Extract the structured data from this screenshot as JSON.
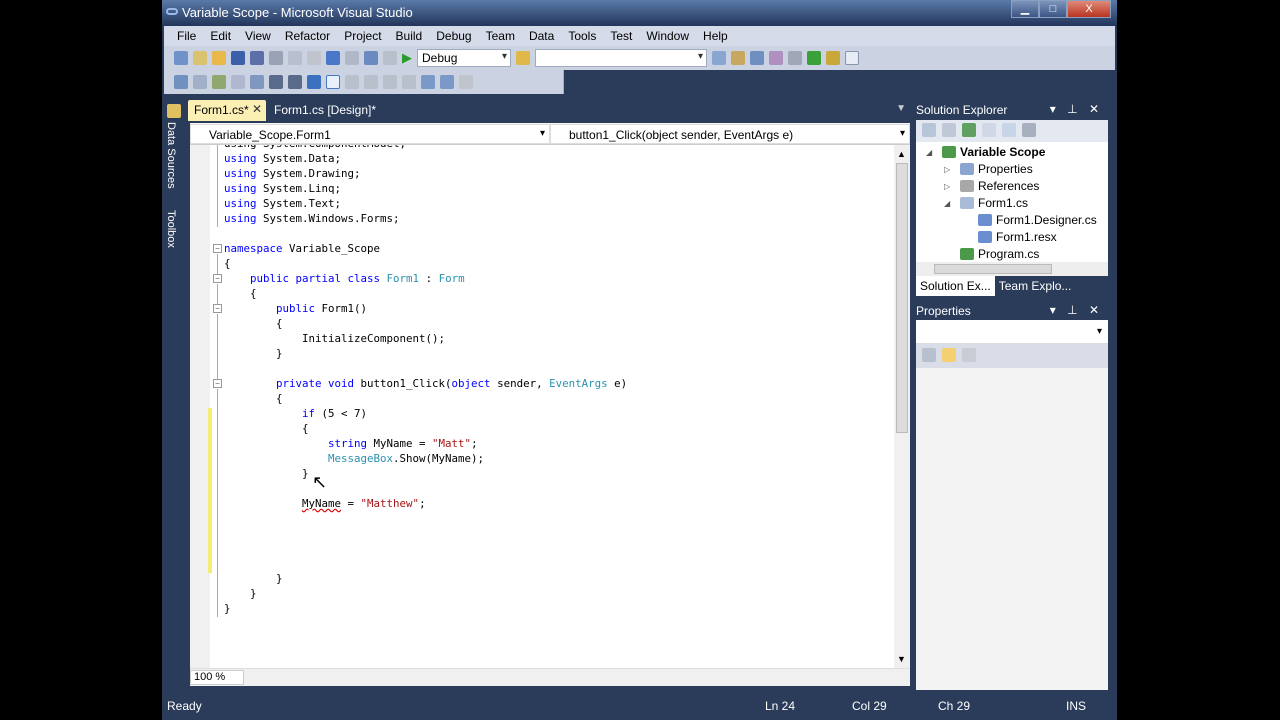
{
  "window": {
    "title": "Variable Scope - Microsoft Visual Studio",
    "min": "▁",
    "max": "□",
    "close": "X"
  },
  "menu": [
    "File",
    "Edit",
    "View",
    "Refactor",
    "Project",
    "Build",
    "Debug",
    "Team",
    "Data",
    "Tools",
    "Test",
    "Window",
    "Help"
  ],
  "toolbar": {
    "config": "Debug",
    "platform": ""
  },
  "tabs": [
    {
      "label": "Form1.cs*",
      "close": "✕"
    },
    {
      "label": "Form1.cs [Design]*"
    }
  ],
  "side": {
    "data_sources": "Data Sources",
    "toolbox": "Toolbox"
  },
  "nav": {
    "type": "Variable_Scope.Form1",
    "member": "button1_Click(object sender, EventArgs e)"
  },
  "code": [
    [
      [
        "",
        "using System.ComponentModel;"
      ]
    ],
    [
      [
        "kw",
        "using"
      ],
      [
        "",
        " System.Data;"
      ]
    ],
    [
      [
        "kw",
        "using"
      ],
      [
        "",
        " System.Drawing;"
      ]
    ],
    [
      [
        "kw",
        "using"
      ],
      [
        "",
        " System.Linq;"
      ]
    ],
    [
      [
        "kw",
        "using"
      ],
      [
        "",
        " System.Text;"
      ]
    ],
    [
      [
        "kw",
        "using"
      ],
      [
        "",
        " System.Windows.Forms;"
      ]
    ],
    [],
    [
      [
        "kw",
        "namespace"
      ],
      [
        "",
        " Variable_Scope"
      ]
    ],
    [
      [
        "",
        "{"
      ]
    ],
    [
      [
        "",
        "    "
      ],
      [
        "kw",
        "public partial class"
      ],
      [
        "",
        " "
      ],
      [
        "ty",
        "Form1"
      ],
      [
        "",
        " : "
      ],
      [
        "ty",
        "Form"
      ]
    ],
    [
      [
        "",
        "    {"
      ]
    ],
    [
      [
        "",
        "        "
      ],
      [
        "kw",
        "public"
      ],
      [
        "",
        " Form1()"
      ]
    ],
    [
      [
        "",
        "        {"
      ]
    ],
    [
      [
        "",
        "            InitializeComponent();"
      ]
    ],
    [
      [
        "",
        "        }"
      ]
    ],
    [],
    [
      [
        "",
        "        "
      ],
      [
        "kw",
        "private void"
      ],
      [
        "",
        " button1_Click("
      ],
      [
        "kw",
        "object"
      ],
      [
        "",
        " sender, "
      ],
      [
        "ty",
        "EventArgs"
      ],
      [
        "",
        " e)"
      ]
    ],
    [
      [
        "",
        "        {"
      ]
    ],
    [
      [
        "",
        "            "
      ],
      [
        "kw",
        "if"
      ],
      [
        "",
        " (5 < 7)"
      ]
    ],
    [
      [
        "",
        "            {"
      ]
    ],
    [
      [
        "",
        "                "
      ],
      [
        "kw",
        "string"
      ],
      [
        "",
        " MyName = "
      ],
      [
        "st",
        "\"Matt\""
      ],
      [
        "",
        ";"
      ]
    ],
    [
      [
        "",
        "                "
      ],
      [
        "ty",
        "MessageBox"
      ],
      [
        "",
        ".Show(MyName);"
      ]
    ],
    [
      [
        "",
        "            }"
      ]
    ],
    [],
    [
      [
        "",
        "            "
      ],
      [
        "err",
        "MyName"
      ],
      [
        "",
        " = "
      ],
      [
        "st",
        "\"Matthew\""
      ],
      [
        "",
        ";"
      ]
    ],
    [],
    [],
    [],
    [],
    [
      [
        "",
        "        }"
      ]
    ],
    [
      [
        "",
        "    }"
      ]
    ],
    [
      [
        "",
        "}"
      ]
    ]
  ],
  "editor": {
    "zoom": "100 %"
  },
  "status": {
    "text": "Ready",
    "ln": "Ln 24",
    "col": "Col 29",
    "ch": "Ch 29",
    "mode": "INS"
  },
  "solution_explorer": {
    "title": "Solution Explorer",
    "items": [
      "Variable Scope",
      "Properties",
      "References",
      "Form1.cs",
      "Form1.Designer.cs",
      "Form1.resx",
      "Program.cs"
    ],
    "tabs": [
      "Solution Ex...",
      "Team Explo..."
    ]
  },
  "properties": {
    "title": "Properties"
  }
}
